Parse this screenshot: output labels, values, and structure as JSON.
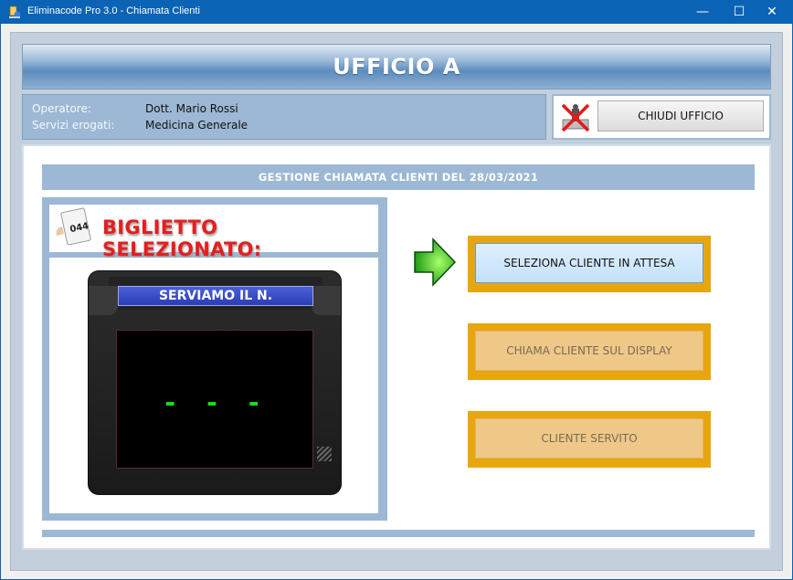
{
  "window": {
    "title": "Eliminacode Pro 3.0 - Chiamata Clienti",
    "minimize": "—",
    "maximize": "☐",
    "close": "✕"
  },
  "header": {
    "office_title": "UFFICIO A"
  },
  "info": {
    "operator_label": "Operatore:",
    "operator_value": "Dott. Mario Rossi",
    "services_label": "Servizi erogati:",
    "services_value": "Medicina Generale"
  },
  "close_office": {
    "label": "CHIUDI UFFICIO",
    "icon": "no-entry-icon"
  },
  "section": {
    "title": "GESTIONE CHIAMATA CLIENTI DEL 28/03/2021"
  },
  "ticket": {
    "title": "BIGLIETTO SELEZIONATO:",
    "icon_number": "044",
    "display_label": "SERVIAMO IL N.",
    "number": "- - -"
  },
  "actions": [
    {
      "label": "SELEZIONA CLIENTE IN ATTESA",
      "enabled": true
    },
    {
      "label": "CHIAMA CLIENTE SUL DISPLAY",
      "enabled": false
    },
    {
      "label": "CLIENTE SERVITO",
      "enabled": false
    }
  ],
  "colors": {
    "titlebar": "#0a63b4",
    "panel": "#9cb8d4",
    "accent_orange": "#e8a60e",
    "ticket_red": "#e61e1e",
    "display_green": "#1adc1a"
  }
}
